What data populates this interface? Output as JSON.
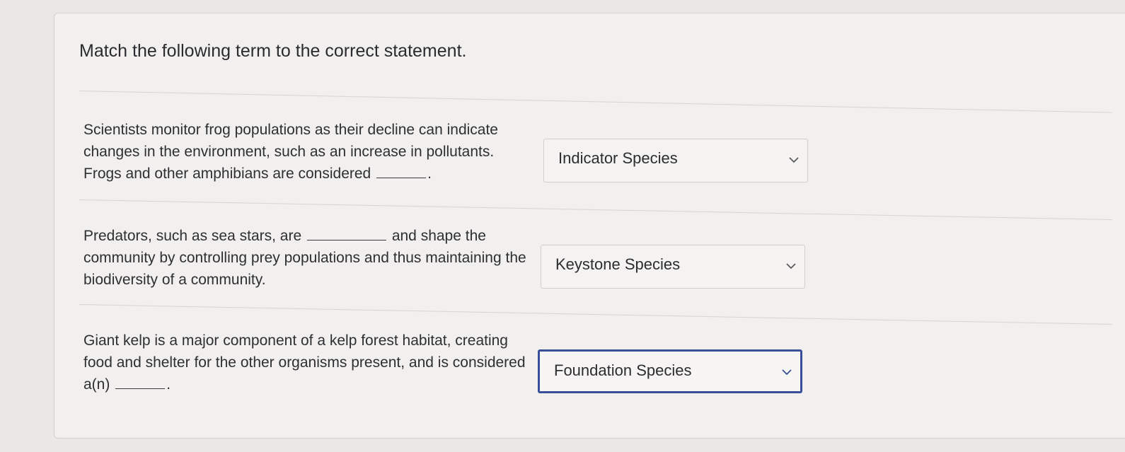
{
  "question": {
    "prompt": "Match the following term to the correct statement."
  },
  "items": [
    {
      "statement_before": "Scientists monitor frog populations as their decline can indicate changes in the environment, such as an increase in pollutants. Frogs and other amphibians are considered",
      "statement_after": ".",
      "selected": "Indicator Species"
    },
    {
      "statement_before": "Predators, such as sea stars, are",
      "statement_after": "and shape the community by controlling prey populations and thus maintaining the biodiversity of a community.",
      "selected": "Keystone Species"
    },
    {
      "statement_before": "Giant kelp is a major component of a kelp forest habitat, creating food and shelter for the other organisms present, and is considered a(n)",
      "statement_after": ".",
      "selected": "Foundation Species"
    }
  ],
  "colors": {
    "focus_border": "#3a4f9a",
    "background": "#e9e8e6"
  },
  "icons": {
    "dropdown": "chevron-down-icon"
  }
}
